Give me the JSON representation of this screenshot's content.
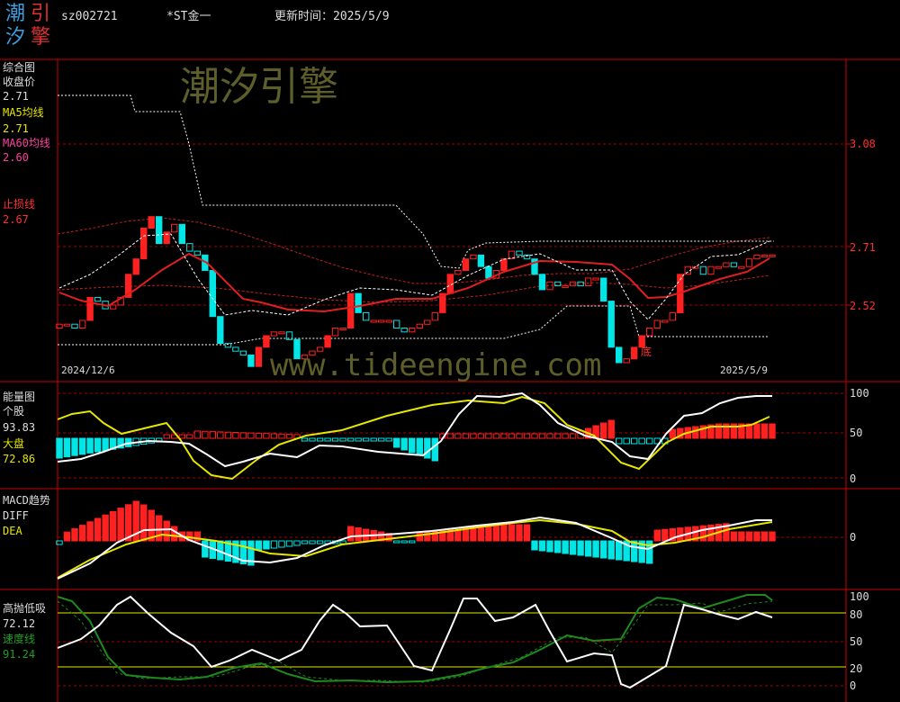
{
  "header": {
    "logo_chars": [
      "潮",
      "引",
      "汐",
      "擎"
    ],
    "code": "sz002721",
    "name": "*ST金一",
    "update_label": "更新时间：2025/5/9"
  },
  "watermarks": {
    "brand": "潮汐引擎",
    "url": "www.tideengine.com"
  },
  "colors": {
    "up": "#ff2020",
    "down": "#00e5e5",
    "grid_red": "#cc0000",
    "ma5": "#ffffff",
    "ma60": "#e02020",
    "yellow": "#e6e600",
    "green": "#1e8a1e",
    "stop": "#ff3030"
  },
  "panel_main": {
    "title": "综合图",
    "close_label": "收盘价",
    "close_value": "2.71",
    "ma5_label": "MA5均线",
    "ma5_value": "2.71",
    "ma60_label": "MA60均线",
    "ma60_value": "2.60",
    "stop_label": "止损线",
    "stop_value": "2.67",
    "axis": [
      "3.08",
      "2.71",
      "2.52"
    ],
    "date_start": "2024/12/6",
    "date_end": "2025/5/9",
    "bottom_mark": "底"
  },
  "panel_energy": {
    "title": "能量图",
    "stock_label": "个股",
    "stock_value": "93.83",
    "market_label": "大盘",
    "market_value": "72.86",
    "axis": [
      "100",
      "50",
      "0"
    ]
  },
  "panel_macd": {
    "title": "MACD趋势",
    "diff_label": "DIFF",
    "dea_label": "DEA",
    "axis": [
      "0"
    ]
  },
  "panel_osc": {
    "title": "高抛低吸",
    "value": "72.12",
    "speed_label": "速度线",
    "speed_value": "91.24",
    "axis": [
      "100",
      "80",
      "50",
      "20",
      "0"
    ]
  },
  "chart_data": {
    "type": "candlestick",
    "y_range": [
      2.39,
      3.21
    ],
    "close": [
      2.53,
      2.53,
      2.52,
      2.54,
      2.6,
      2.59,
      2.57,
      2.58,
      2.6,
      2.66,
      2.7,
      2.78,
      2.81,
      2.74,
      2.77,
      2.79,
      2.74,
      2.72,
      2.71,
      2.67,
      2.55,
      2.48,
      2.47,
      2.46,
      2.45,
      2.42,
      2.47,
      2.5,
      2.51,
      2.51,
      2.49,
      2.44,
      2.45,
      2.46,
      2.47,
      2.5,
      2.52,
      2.52,
      2.61,
      2.56,
      2.54,
      2.54,
      2.54,
      2.54,
      2.52,
      2.51,
      2.52,
      2.53,
      2.54,
      2.56,
      2.61,
      2.66,
      2.67,
      2.7,
      2.71,
      2.68,
      2.65,
      2.67,
      2.7,
      2.72,
      2.71,
      2.7,
      2.66,
      2.62,
      2.64,
      2.63,
      2.63,
      2.64,
      2.63,
      2.65,
      2.65,
      2.59,
      2.47,
      2.43,
      2.44,
      2.47,
      2.5,
      2.52,
      2.54,
      2.54,
      2.56,
      2.66,
      2.68,
      2.68,
      2.66,
      2.68,
      2.68,
      2.69,
      2.68,
      2.68,
      2.7,
      2.71,
      2.71,
      2.71
    ]
  }
}
